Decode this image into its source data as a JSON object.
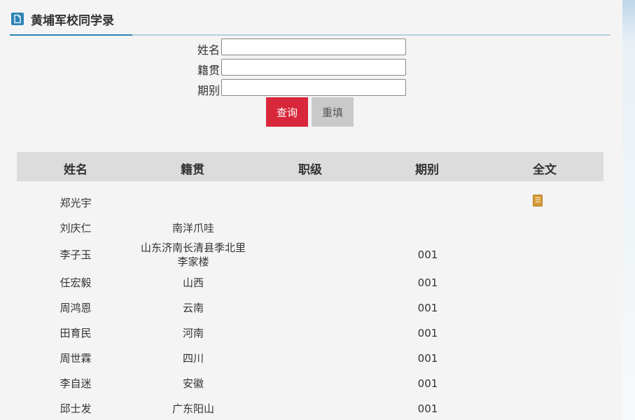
{
  "header": {
    "title": "黄埔军校同学录"
  },
  "form": {
    "name_label": "姓名",
    "origin_label": "籍贯",
    "period_label": "期别",
    "name_value": "",
    "origin_value": "",
    "period_value": "",
    "query_label": "查询",
    "reset_label": "重填"
  },
  "table": {
    "headers": [
      "姓名",
      "籍贯",
      "职级",
      "期别",
      "全文"
    ],
    "rows": [
      {
        "name": "郑光宇",
        "origin": "",
        "rank": "",
        "period": "",
        "has_fulltext": true
      },
      {
        "name": "刘庆仁",
        "origin": "南洋爪哇",
        "rank": "",
        "period": "",
        "has_fulltext": false
      },
      {
        "name": "李子玉",
        "origin": "山东济南长清县季北里李家楼",
        "rank": "",
        "period": "001",
        "has_fulltext": false
      },
      {
        "name": "任宏毅",
        "origin": "山西",
        "rank": "",
        "period": "001",
        "has_fulltext": false
      },
      {
        "name": "周鸿恩",
        "origin": "云南",
        "rank": "",
        "period": "001",
        "has_fulltext": false
      },
      {
        "name": "田育民",
        "origin": "河南",
        "rank": "",
        "period": "001",
        "has_fulltext": false
      },
      {
        "name": "周世霖",
        "origin": "四川",
        "rank": "",
        "period": "001",
        "has_fulltext": false
      },
      {
        "name": "李自迷",
        "origin": "安徽",
        "rank": "",
        "period": "001",
        "has_fulltext": false
      },
      {
        "name": "邱士发",
        "origin": "广东阳山",
        "rank": "",
        "period": "001",
        "has_fulltext": false
      }
    ]
  },
  "icons": {
    "header": "document-icon",
    "fulltext": "book-icon"
  },
  "colors": {
    "accent": "#2d84b6",
    "query_button": "#d8273b",
    "reset_button": "#c9c9c9",
    "table_header_bg": "#dcdcdc",
    "fulltext_icon": "#d49b38"
  }
}
